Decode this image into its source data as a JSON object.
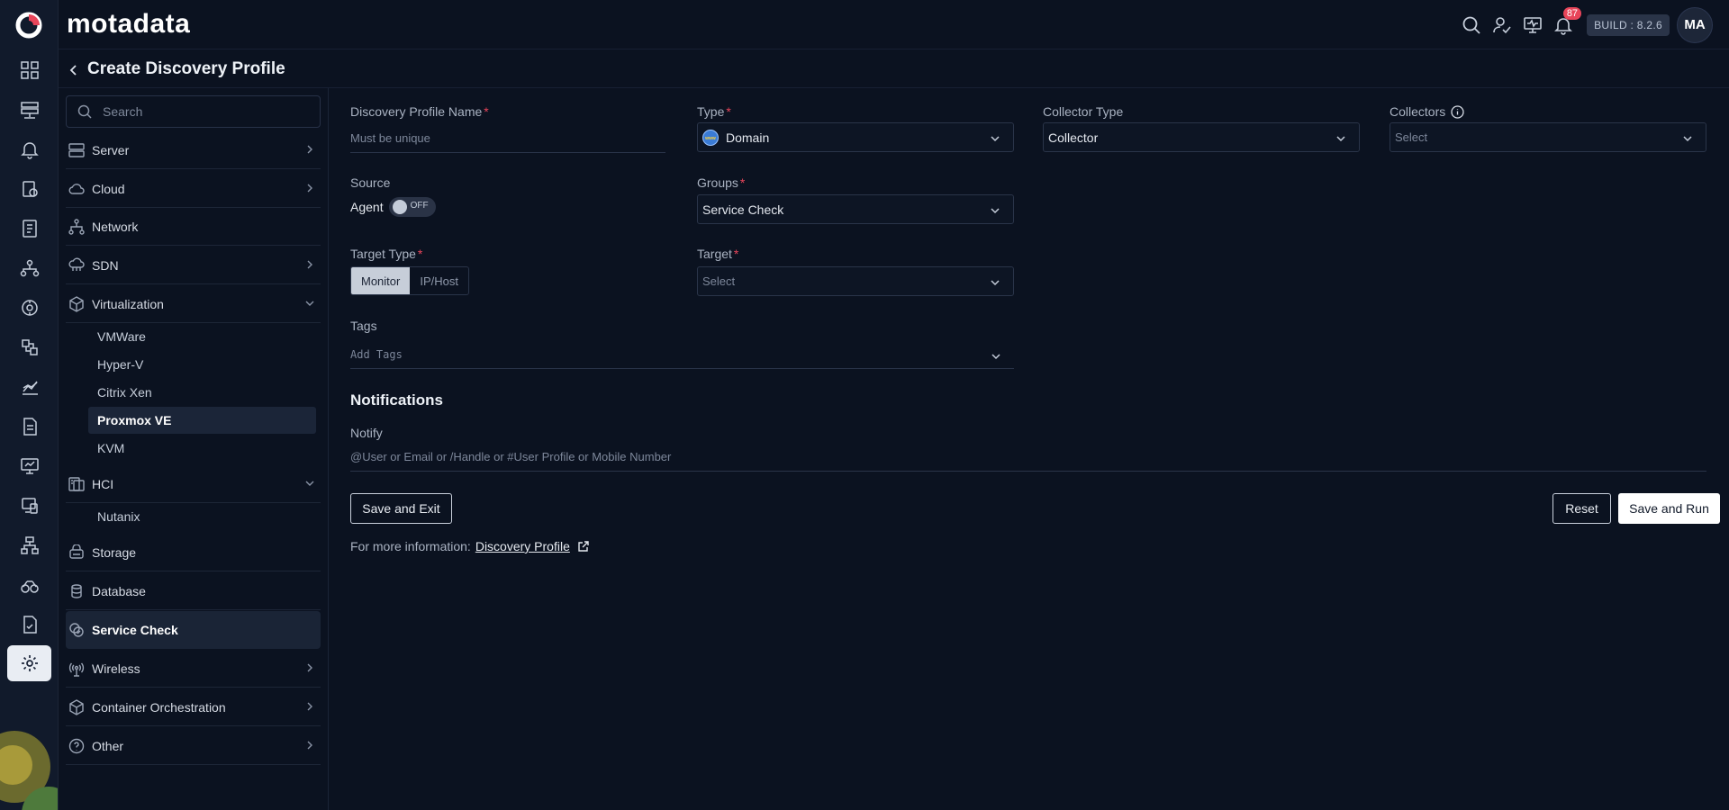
{
  "app": {
    "brand": "motadata",
    "build": "BUILD : 8.2.6",
    "user_initials": "MA",
    "notification_count": "87"
  },
  "page": {
    "title": "Create Discovery Profile"
  },
  "sidebar": {
    "search_placeholder": "Search",
    "categories": [
      {
        "label": "Server",
        "icon": "server-icon"
      },
      {
        "label": "Cloud",
        "icon": "cloud-icon"
      },
      {
        "label": "Network",
        "icon": "network-icon"
      },
      {
        "label": "SDN",
        "icon": "sdn-icon"
      },
      {
        "label": "Virtualization",
        "icon": "cube-icon"
      },
      {
        "label": "HCI",
        "icon": "hci-icon"
      },
      {
        "label": "Storage",
        "icon": "storage-icon"
      },
      {
        "label": "Database",
        "icon": "database-icon"
      },
      {
        "label": "Service Check",
        "icon": "service-check-icon"
      },
      {
        "label": "Wireless",
        "icon": "wireless-icon"
      },
      {
        "label": "Container Orchestration",
        "icon": "container-icon"
      },
      {
        "label": "Other",
        "icon": "help-icon"
      }
    ],
    "virtualization_items": [
      "VMWare",
      "Hyper-V",
      "Citrix Xen",
      "Proxmox VE",
      "KVM"
    ],
    "hci_items": [
      "Nutanix"
    ]
  },
  "form": {
    "profile_name": {
      "label": "Discovery Profile Name",
      "placeholder": "Must be unique",
      "value": ""
    },
    "type": {
      "label": "Type",
      "value": "Domain"
    },
    "collector_type": {
      "label": "Collector Type",
      "value": "Collector"
    },
    "collectors": {
      "label": "Collectors",
      "placeholder": "Select"
    },
    "source": {
      "label": "Source",
      "agent_label": "Agent",
      "toggle_text": "OFF"
    },
    "groups": {
      "label": "Groups",
      "value": "Service Check"
    },
    "target_type": {
      "label": "Target Type",
      "options": [
        "Monitor",
        "IP/Host"
      ],
      "selected": "Monitor"
    },
    "target": {
      "label": "Target",
      "placeholder": "Select"
    },
    "tags": {
      "label": "Tags",
      "placeholder": "Add Tags"
    },
    "notifications": {
      "title": "Notifications",
      "notify_label": "Notify",
      "notify_placeholder": "@User or Email or /Handle or #User Profile or Mobile Number"
    },
    "buttons": {
      "save_exit": "Save and Exit",
      "reset": "Reset",
      "save_run": "Save and Run"
    },
    "more_info": {
      "prefix": "For more information:",
      "link": "Discovery Profile"
    }
  },
  "colors": {
    "background": "#0b1220",
    "rail": "#111a2b",
    "accent_required": "#e8455a",
    "badge": "#e8455a"
  }
}
